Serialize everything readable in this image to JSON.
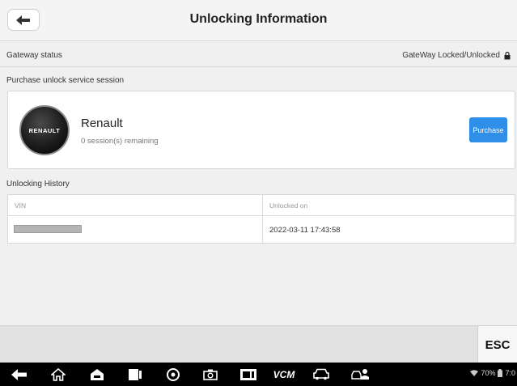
{
  "header": {
    "title": "Unlocking Information"
  },
  "gateway": {
    "label": "Gateway status",
    "status": "GateWay Locked/Unlocked"
  },
  "purchase_section": {
    "label": "Purchase unlock service session"
  },
  "vehicle": {
    "logo_text": "RENAULT",
    "brand": "Renault",
    "sessions": "0 session(s) remaining",
    "purchase_label": "Purchase"
  },
  "history": {
    "label": "Unlocking History",
    "columns": [
      "VIN",
      "Unlocked on"
    ],
    "rows": [
      {
        "unlocked_on": "2022-03-11 17:43:58"
      }
    ]
  },
  "footer": {
    "esc_label": "ESC"
  },
  "navbar": {
    "icons": [
      "back-icon",
      "home-icon",
      "car-home-icon",
      "recent-apps-icon",
      "chrome-icon",
      "camera-icon",
      "screen-capture-icon",
      "vcm-icon",
      "car-icon",
      "car-user-icon"
    ],
    "vcm_label": "VCM",
    "status_text": "70%",
    "time_text": "7:0"
  }
}
